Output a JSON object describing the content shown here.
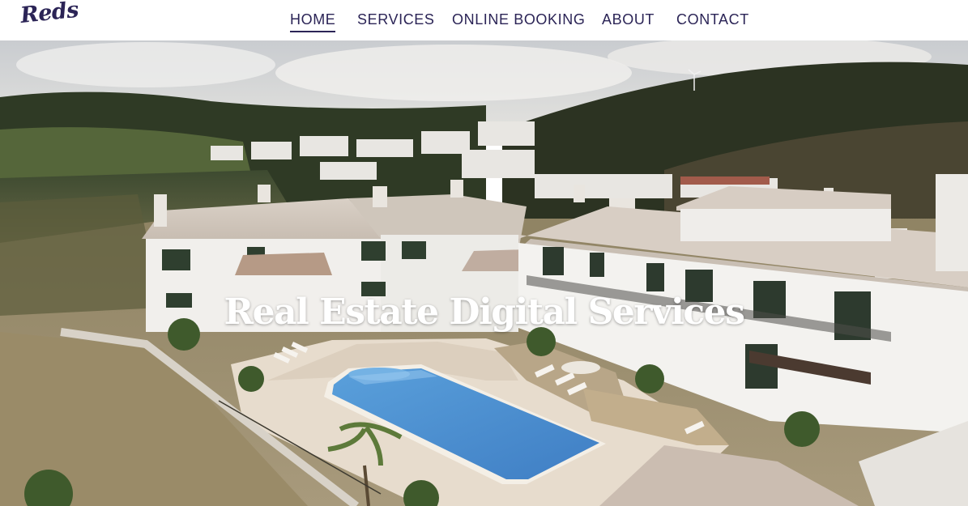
{
  "brand": {
    "logo_text": "Reds"
  },
  "nav": {
    "items": [
      {
        "label": "HOME",
        "active": true
      },
      {
        "label": "SERVICES",
        "active": false
      },
      {
        "label": "ONLINE BOOKING",
        "active": false
      },
      {
        "label": "ABOUT",
        "active": false
      },
      {
        "label": "CONTACT",
        "active": false
      }
    ]
  },
  "hero": {
    "headline": "Real Estate Digital Services",
    "image": "aerial-villa-pool-photo"
  },
  "colors": {
    "brand": "#2b2456",
    "header_bg": "#ffffff",
    "headline": "#ffffff",
    "pool": "#4a8fd0"
  }
}
